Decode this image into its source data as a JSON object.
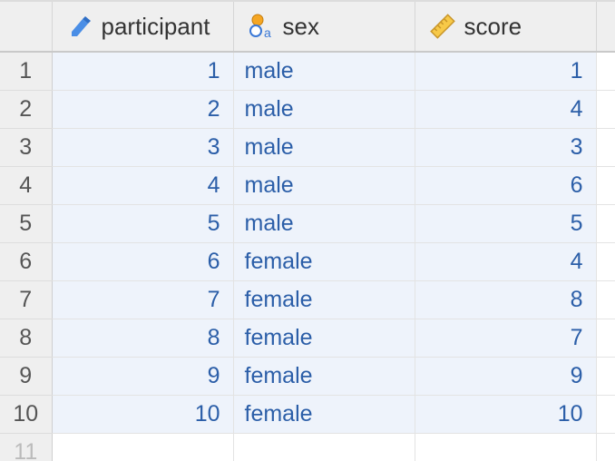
{
  "columns": {
    "participant": {
      "label": "participant",
      "icon": "continuous-ruler-pencil-icon"
    },
    "sex": {
      "label": "sex",
      "icon": "nominal-text-icon"
    },
    "score": {
      "label": "score",
      "icon": "ruler-icon"
    }
  },
  "rows": [
    {
      "n": "1",
      "participant": "1",
      "sex": "male",
      "score": "1"
    },
    {
      "n": "2",
      "participant": "2",
      "sex": "male",
      "score": "4"
    },
    {
      "n": "3",
      "participant": "3",
      "sex": "male",
      "score": "3"
    },
    {
      "n": "4",
      "participant": "4",
      "sex": "male",
      "score": "6"
    },
    {
      "n": "5",
      "participant": "5",
      "sex": "male",
      "score": "5"
    },
    {
      "n": "6",
      "participant": "6",
      "sex": "female",
      "score": "4"
    },
    {
      "n": "7",
      "participant": "7",
      "sex": "female",
      "score": "8"
    },
    {
      "n": "8",
      "participant": "8",
      "sex": "female",
      "score": "7"
    },
    {
      "n": "9",
      "participant": "9",
      "sex": "female",
      "score": "9"
    },
    {
      "n": "10",
      "participant": "10",
      "sex": "female",
      "score": "10"
    }
  ],
  "empty_row": {
    "n": "11"
  },
  "colors": {
    "cell_text": "#2b5ea8",
    "header_bg": "#efefef",
    "filled_cell_bg": "#eef3fb"
  }
}
